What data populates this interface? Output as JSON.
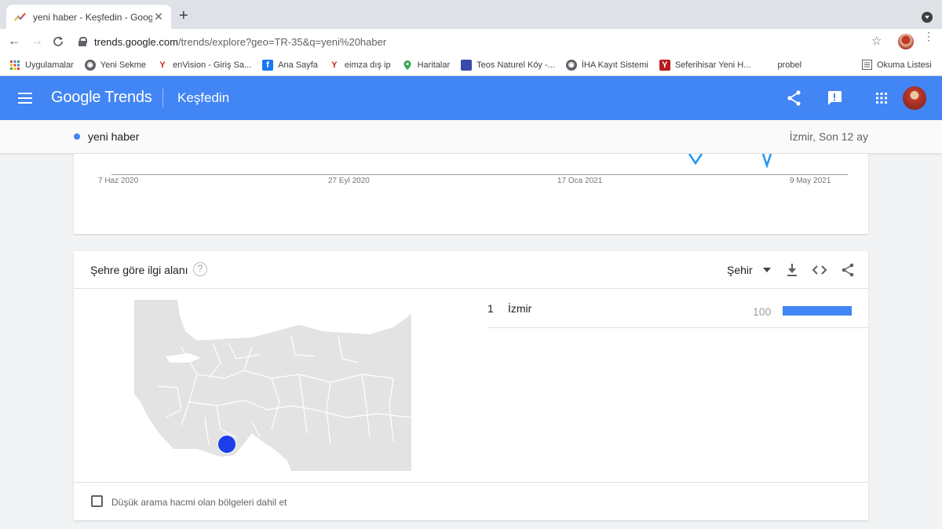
{
  "browser": {
    "tab_title": "yeni haber - Keşfedin - Google Trends",
    "new_tab_symbol": "+",
    "close_symbol": "✕",
    "url_host": "trends.google.com",
    "url_path": "/trends/explore?geo=TR-35&q=yeni%20haber"
  },
  "bookmarks": {
    "items": [
      {
        "label": "Uygulamalar",
        "icon": "apps-grid-icon"
      },
      {
        "label": "Yeni Sekme",
        "icon": "globe-icon"
      },
      {
        "label": "enVision - Giriş Sa...",
        "icon": "y-logo-icon"
      },
      {
        "label": "Ana Sayfa",
        "icon": "facebook-icon"
      },
      {
        "label": "eimza dış ip",
        "icon": "y-logo-icon"
      },
      {
        "label": "Haritalar",
        "icon": "maps-pin-icon"
      },
      {
        "label": "Teos Naturel Köy -...",
        "icon": "site-icon"
      },
      {
        "label": "İHA Kayıt Sistemi",
        "icon": "globe-icon"
      },
      {
        "label": "Seferihisar Yeni H...",
        "icon": "y-logo-icon"
      },
      {
        "label": "probel",
        "icon": ""
      }
    ],
    "reading_list": "Okuma Listesi"
  },
  "header": {
    "brand": "Google Trends",
    "section": "Keşfedin"
  },
  "term": {
    "name": "yeni haber",
    "meta": "İzmir, Son 12 ay",
    "color": "#4285f4"
  },
  "timeline": {
    "ticks": [
      "7 Haz 2020",
      "27 Eyl 2020",
      "17 Oca 2021",
      "9 May 2021"
    ]
  },
  "region_card": {
    "title": "Şehre göre ilgi alanı",
    "help_symbol": "?",
    "resolution": "Şehir",
    "ranking": [
      {
        "rank": "1",
        "name": "İzmir",
        "value": "100",
        "fill_fraction": 1.0
      }
    ],
    "checkbox_label": "Düşük arama hacmi olan bölgeleri dahil et",
    "checkbox_checked": false
  },
  "colors": {
    "accent": "#4285f4",
    "marker": "#1a3ee8"
  }
}
